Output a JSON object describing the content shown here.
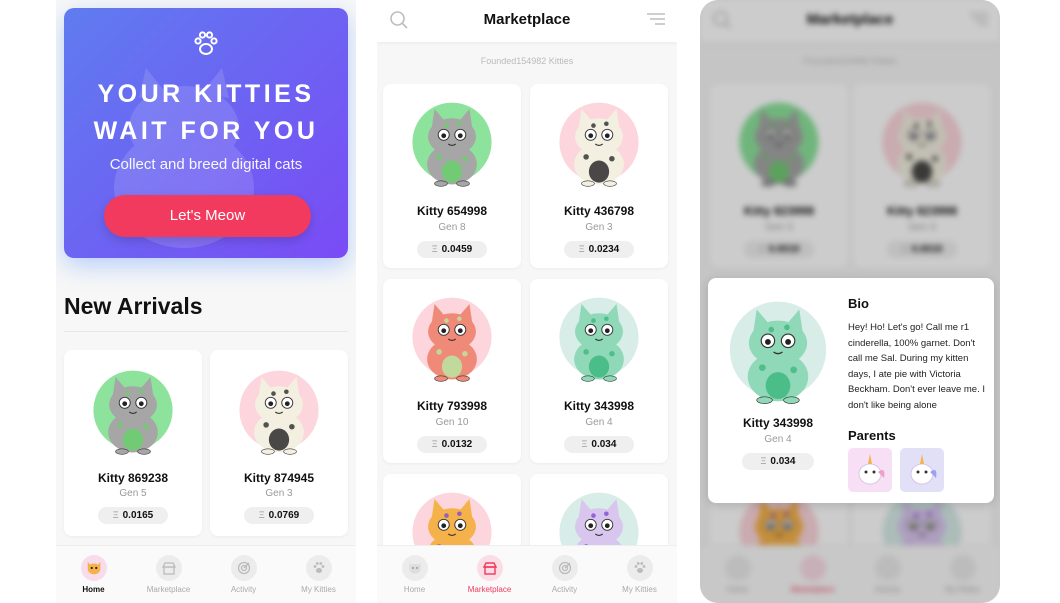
{
  "screen1": {
    "hero": {
      "title": "YOUR KITTIES\nWAIT FOR YOU",
      "subtitle": "Collect and breed digital cats",
      "button": "Let's Meow",
      "icon": "paw-icon"
    },
    "section_title": "New Arrivals",
    "cards": [
      {
        "name": "Kitty 869238",
        "gen": "Gen 5",
        "price": "0.0165",
        "circle": "#8de39c",
        "body": "#a6a6a6",
        "accent": "#6ad06c"
      },
      {
        "name": "Kitty 874945",
        "gen": "Gen 3",
        "price": "0.0769",
        "circle": "#fcd6dc",
        "body": "#f3f0e1",
        "accent": "#2a2a2a"
      }
    ]
  },
  "screen2": {
    "title": "Marketplace",
    "founded": "Founded154982 Kitties",
    "cards": [
      {
        "name": "Kitty 654998",
        "gen": "Gen 8",
        "price": "0.0459",
        "circle": "#8de39c",
        "body": "#a6a6a6",
        "accent": "#6ad06c"
      },
      {
        "name": "Kitty 436798",
        "gen": "Gen 3",
        "price": "0.0234",
        "circle": "#fcd6dc",
        "body": "#f3f0e1",
        "accent": "#2a2a2a"
      },
      {
        "name": "Kitty 793998",
        "gen": "Gen 10",
        "price": "0.0132",
        "circle": "#fcd6dc",
        "body": "#f08a78",
        "accent": "#b9e8a2"
      },
      {
        "name": "Kitty 343998",
        "gen": "Gen 4",
        "price": "0.034",
        "circle": "#d8ece8",
        "body": "#8fd8b8",
        "accent": "#3fb87f"
      },
      {
        "name": "",
        "gen": "",
        "price": "",
        "circle": "#fcd6dc",
        "body": "#f5b24a",
        "accent": "#7e4bd6"
      },
      {
        "name": "",
        "gen": "",
        "price": "",
        "circle": "#d8ece8",
        "body": "#d9c6ef",
        "accent": "#7e4bd6"
      }
    ]
  },
  "screen3": {
    "title": "Marketplace",
    "founded": "Founded154982 Kitties",
    "cards": [
      {
        "name": "Kitty 823998",
        "gen": "Gen 3",
        "price": "0.0019"
      },
      {
        "name": "Kitty 823998",
        "gen": "Gen 3",
        "price": "0.0019"
      }
    ],
    "modal": {
      "name": "Kitty 343998",
      "gen": "Gen 4",
      "price": "0.034",
      "bio_heading": "Bio",
      "bio": "Hey! Ho! Let's go! Call me r1 cinderella, 100% garnet. Don't call me Sal. During my kitten days, I ate pie with Victoria Beckham. Don't ever leave me. I don't like being alone",
      "parents_heading": "Parents"
    }
  },
  "tabs": [
    {
      "label": "Home",
      "icon": "cat-face-icon"
    },
    {
      "label": "Marketplace",
      "icon": "store-icon"
    },
    {
      "label": "Activity",
      "icon": "activity-icon"
    },
    {
      "label": "My Kitties",
      "icon": "paw-icon"
    }
  ],
  "colors": {
    "accent": "#f13a5d",
    "hero_start": "#5f7cf0",
    "hero_end": "#7a4bf5"
  },
  "currency_symbol": "Ξ"
}
